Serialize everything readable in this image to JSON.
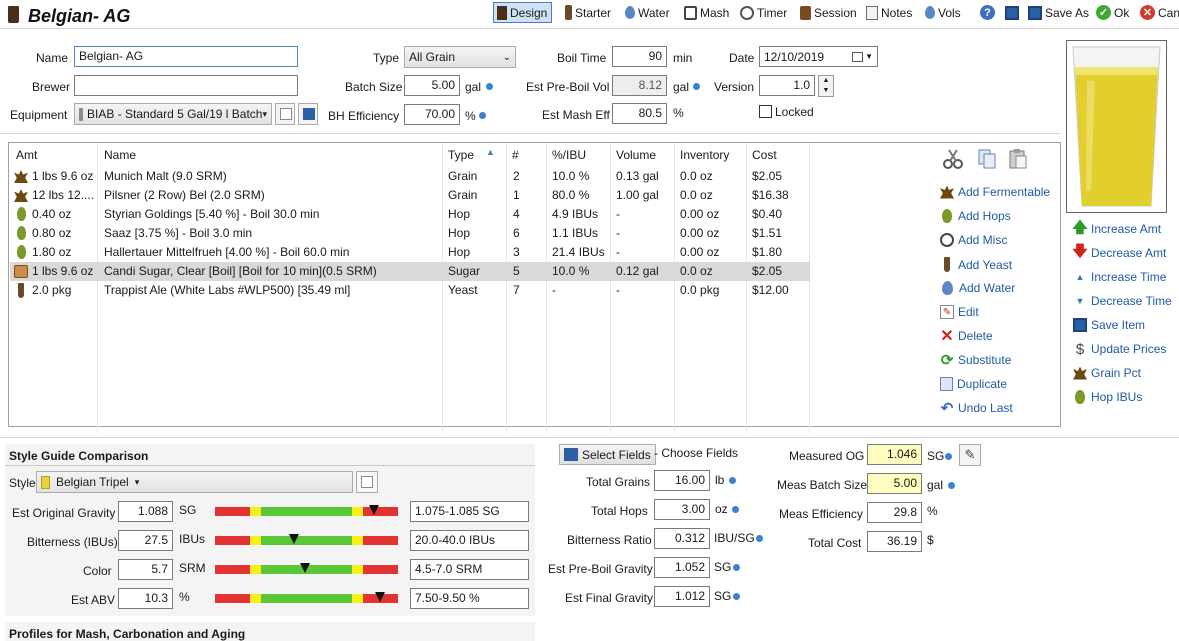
{
  "title": "Belgian- AG",
  "toolbar": {
    "design": "Design",
    "starter": "Starter",
    "water": "Water",
    "mash": "Mash",
    "timer": "Timer",
    "session": "Session",
    "notes": "Notes",
    "vols": "Vols",
    "save_as": "Save As",
    "ok": "Ok",
    "cancel": "Can"
  },
  "form": {
    "name_label": "Name",
    "name_value": "Belgian- AG",
    "brewer_label": "Brewer",
    "brewer_value": "",
    "equipment_label": "Equipment",
    "equipment_value": "BIAB - Standard 5 Gal/19 l Batch",
    "type_label": "Type",
    "type_value": "All Grain",
    "batch_size_label": "Batch Size",
    "batch_size_value": "5.00",
    "batch_size_unit": "gal",
    "bh_eff_label": "BH Efficiency",
    "bh_eff_value": "70.00",
    "bh_eff_unit": "%",
    "boil_time_label": "Boil Time",
    "boil_time_value": "90",
    "boil_time_unit": "min",
    "pre_boil_vol_label": "Est Pre-Boil Vol",
    "pre_boil_vol_value": "8.12",
    "pre_boil_vol_unit": "gal",
    "mash_eff_label": "Est Mash Eff",
    "mash_eff_value": "80.5",
    "mash_eff_unit": "%",
    "date_label": "Date",
    "date_value": "12/10/2019",
    "version_label": "Version",
    "version_value": "1.0",
    "locked_label": "Locked"
  },
  "ingredients": {
    "headers": [
      "Amt",
      "Name",
      "Type",
      "#",
      "%/IBU",
      "Volume",
      "Inventory",
      "Cost"
    ],
    "rows": [
      {
        "icon": "grain",
        "amt": "1 lbs 9.6 oz",
        "name": "Munich Malt (9.0 SRM)",
        "type": "Grain",
        "num": "2",
        "pct": "10.0 %",
        "volume": "0.13 gal",
        "inventory": "0.0 oz",
        "cost": "$2.05"
      },
      {
        "icon": "grain",
        "amt": "12 lbs 12....",
        "name": "Pilsner (2 Row) Bel (2.0 SRM)",
        "type": "Grain",
        "num": "1",
        "pct": "80.0 %",
        "volume": "1.00 gal",
        "inventory": "0.0 oz",
        "cost": "$16.38"
      },
      {
        "icon": "hop",
        "amt": "0.40 oz",
        "name": "Styrian Goldings [5.40 %] - Boil 30.0 min",
        "type": "Hop",
        "num": "4",
        "pct": "4.9 IBUs",
        "volume": "-",
        "inventory": "0.00 oz",
        "cost": "$0.40"
      },
      {
        "icon": "hop",
        "amt": "0.80 oz",
        "name": "Saaz [3.75 %] - Boil 3.0 min",
        "type": "Hop",
        "num": "6",
        "pct": "1.1 IBUs",
        "volume": "-",
        "inventory": "0.00 oz",
        "cost": "$1.51"
      },
      {
        "icon": "hop",
        "amt": "1.80 oz",
        "name": "Hallertauer Mittelfrueh [4.00 %] - Boil 60.0 min",
        "type": "Hop",
        "num": "3",
        "pct": "21.4 IBUs",
        "volume": "-",
        "inventory": "0.00 oz",
        "cost": "$1.80"
      },
      {
        "icon": "sugar",
        "amt": "1 lbs 9.6 oz",
        "name": "Candi Sugar, Clear [Boil] [Boil for 10 min](0.5 SRM)",
        "type": "Sugar",
        "num": "5",
        "pct": "10.0 %",
        "volume": "0.12 gal",
        "inventory": "0.0 oz",
        "cost": "$2.05"
      },
      {
        "icon": "yeast",
        "amt": "2.0 pkg",
        "name": "Trappist Ale (White Labs #WLP500) [35.49 ml]",
        "type": "Yeast",
        "num": "7",
        "pct": "-",
        "volume": "-",
        "inventory": "0.0 pkg",
        "cost": "$12.00"
      }
    ]
  },
  "actions": {
    "add_fermentable": "Add Fermentable",
    "add_hops": "Add Hops",
    "add_misc": "Add Misc",
    "add_yeast": "Add Yeast",
    "add_water": "Add Water",
    "edit": "Edit",
    "delete": "Delete",
    "substitute": "Substitute",
    "duplicate": "Duplicate",
    "undo_last": "Undo Last",
    "increase_amt": "Increase Amt",
    "decrease_amt": "Decrease Amt",
    "increase_time": "Increase Time",
    "decrease_time": "Decrease Time",
    "save_item": "Save Item",
    "update_prices": "Update Prices",
    "grain_pct": "Grain Pct",
    "hop_ibus": "Hop IBUs"
  },
  "style_guide": {
    "section_title": "Style Guide Comparison",
    "style_label": "Style",
    "style_value": "Belgian Tripel",
    "og_label": "Est Original Gravity",
    "og_value": "1.088",
    "og_unit": "SG",
    "og_range": "1.075-1.085 SG",
    "og_level": 0.87,
    "ibu_label": "Bitterness (IBUs)",
    "ibu_value": "27.5",
    "ibu_unit": "IBUs",
    "ibu_range": "20.0-40.0 IBUs",
    "ibu_level": 0.43,
    "color_label": "Color",
    "color_value": "5.7",
    "color_unit": "SRM",
    "color_range": "4.5-7.0 SRM",
    "color_level": 0.49,
    "abv_label": "Est ABV",
    "abv_value": "10.3",
    "abv_unit": "%",
    "abv_range": "7.50-9.50 %",
    "abv_level": 0.9
  },
  "fields": {
    "select_fields": "Select Fields",
    "choose_fields": "- Choose Fields",
    "total_grains_label": "Total Grains",
    "total_grains_value": "16.00",
    "total_grains_unit": "lb",
    "total_hops_label": "Total Hops",
    "total_hops_value": "3.00",
    "total_hops_unit": "oz",
    "bitterness_ratio_label": "Bitterness Ratio",
    "bitterness_ratio_value": "0.312",
    "bitterness_ratio_unit": "IBU/SG",
    "pre_boil_gravity_label": "Est Pre-Boil Gravity",
    "pre_boil_gravity_value": "1.052",
    "pre_boil_gravity_unit": "SG",
    "final_gravity_label": "Est Final Gravity",
    "final_gravity_value": "1.012",
    "final_gravity_unit": "SG"
  },
  "measured": {
    "og_label": "Measured OG",
    "og_value": "1.046",
    "og_unit": "SG",
    "batch_label": "Meas Batch Size",
    "batch_value": "5.00",
    "batch_unit": "gal",
    "eff_label": "Meas Efficiency",
    "eff_value": "29.8",
    "eff_unit": "%",
    "cost_label": "Total Cost",
    "cost_value": "36.19",
    "cost_unit": "$"
  },
  "profiles_title": "Profiles for Mash, Carbonation and Aging",
  "colors": {
    "beer": "#e2cf2c",
    "accent": "#1e5aa8",
    "selected_row": "#d9d9d9"
  }
}
